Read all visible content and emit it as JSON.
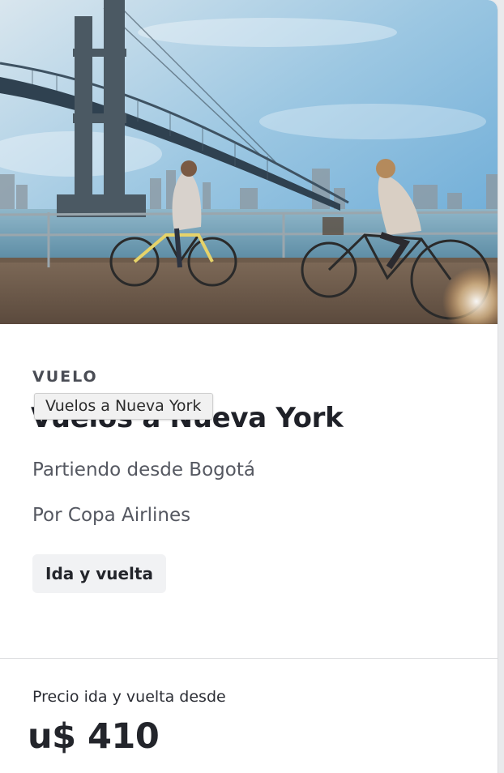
{
  "offer": {
    "category": "VUELO",
    "title": "Vuelos a Nueva York",
    "tooltip": "Vuelos a Nueva York",
    "departure": "Partiendo desde Bogotá",
    "airline": "Por Copa Airlines",
    "trip_type": "Ida y vuelta",
    "price_label": "Precio ida y vuelta desde",
    "price": "u$ 410"
  },
  "colors": {
    "card_background": "#ffffff",
    "tag_background": "#f1f2f4",
    "title_text": "#1f2128",
    "muted_text": "#555861"
  }
}
